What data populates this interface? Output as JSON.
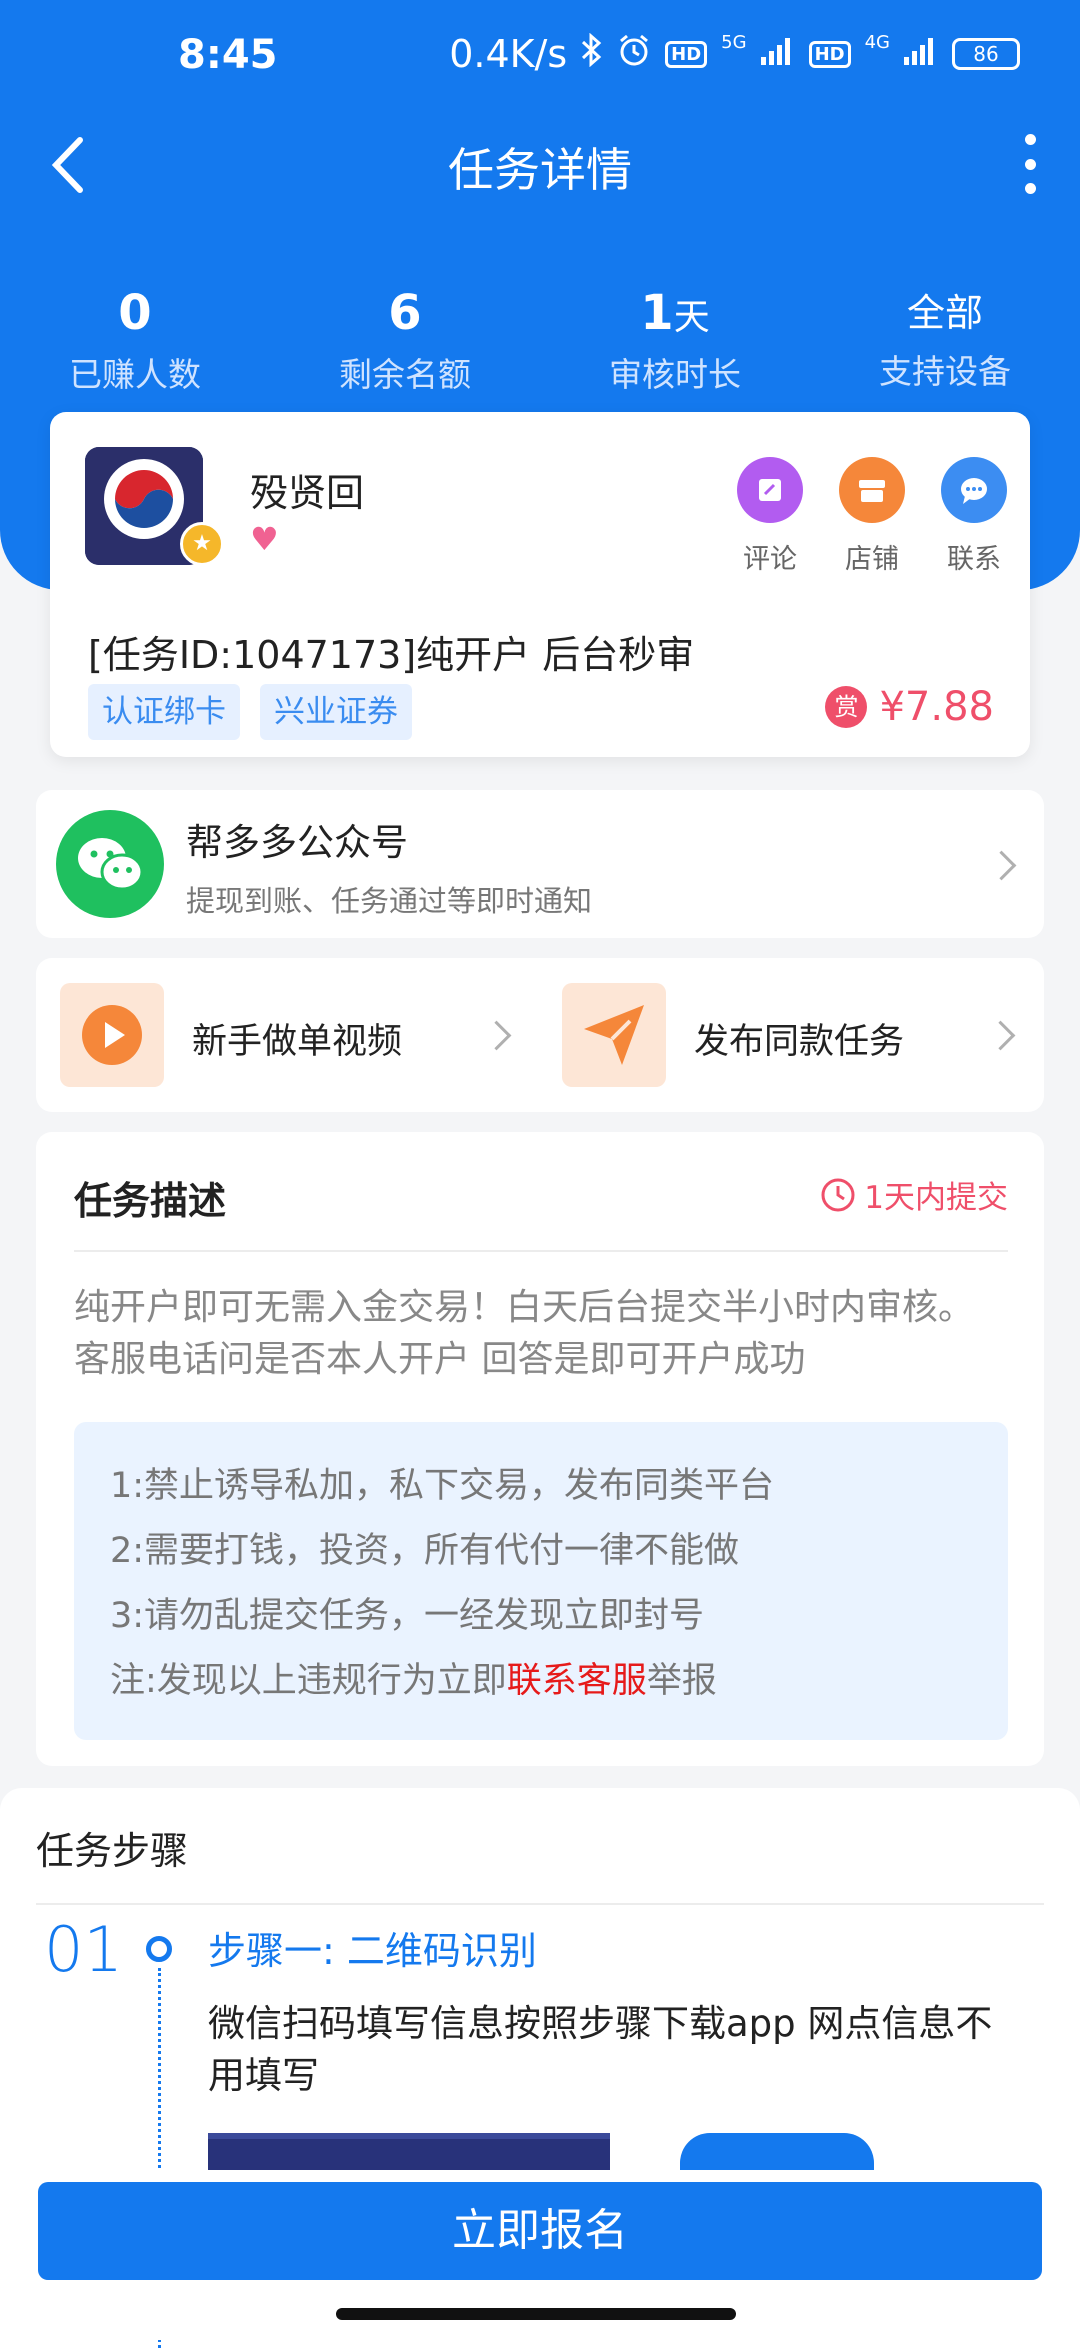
{
  "status_bar": {
    "time": "8:45",
    "net_speed": "0.4K/s",
    "sig1": "5G",
    "sig2": "4G",
    "hd": "HD",
    "battery": "86"
  },
  "nav": {
    "title": "任务详情"
  },
  "stats": [
    {
      "value": "0",
      "unit": "",
      "label": "已赚人数"
    },
    {
      "value": "6",
      "unit": "",
      "label": "剩余名额"
    },
    {
      "value": "1",
      "unit": "天",
      "label": "审核时长"
    },
    {
      "value": "全部",
      "unit": "",
      "label": "支持设备"
    }
  ],
  "task": {
    "poster_name": "殁贤回",
    "actions": [
      {
        "label": "评论",
        "icon": "comment-icon",
        "color": "#b25cf0"
      },
      {
        "label": "店铺",
        "icon": "store-icon",
        "color": "#f5873a"
      },
      {
        "label": "联系",
        "icon": "chat-icon",
        "color": "#3c8df2"
      }
    ],
    "title": "[任务ID:1047173]纯开户 后台秒审",
    "tags": [
      "认证绑卡",
      "兴业证券"
    ],
    "reward_badge": "赏",
    "reward": "¥7.88"
  },
  "wechat": {
    "title": "帮多多公众号",
    "subtitle": "提现到账、任务通过等即时通知"
  },
  "shortcuts": {
    "video_label": "新手做单视频",
    "publish_label": "发布同款任务"
  },
  "description": {
    "title": "任务描述",
    "deadline": "1天内提交",
    "body": "纯开户即可无需入金交易！白天后台提交半小时内审核。客服电话问是否本人开户 回答是即可开户成功",
    "rules": [
      "1:禁止诱导私加，私下交易，发布同类平台",
      "2:需要打钱，投资，所有代付一律不能做",
      "3:请勿乱提交任务，一经发现立即封号"
    ],
    "note_prefix": "注:发现以上违规行为立即",
    "note_link": "联系客服",
    "note_suffix": "举报"
  },
  "steps": {
    "title": "任务步骤",
    "items": [
      {
        "num": "01",
        "name": "步骤一: 二维码识别",
        "text": "微信扫码填写信息按照步骤下载app  网点信息不用填写"
      }
    ]
  },
  "bottom": {
    "signup": "立即报名"
  },
  "colors": {
    "primary": "#1479ee",
    "accent_red": "#ef4f6a"
  }
}
